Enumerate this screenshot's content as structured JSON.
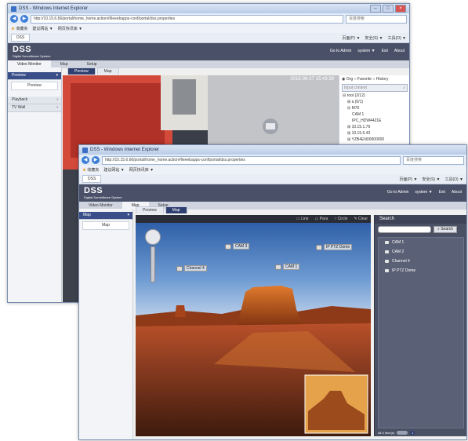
{
  "back_window": {
    "title": "DSS - Windows Internet Explorer",
    "url": "http://10.15.6.66/portal/home_home.action#/lleeebapps-conf/portal/dss.properties",
    "search_placeholder": "百度搜索",
    "fav_items": [
      "收藏夹",
      "建议网站 ▼",
      "网页快讯库 ▼"
    ],
    "tab": "DSS",
    "tools": [
      "页面(P) ▼",
      "安全(S) ▼",
      "工具(O) ▼"
    ],
    "app": {
      "logo": "DSS",
      "subtitle": "Digital Surveillance System",
      "links": [
        "Go to Admin",
        "system ▼",
        "Exit",
        "About"
      ],
      "menu": [
        "Video Monitor",
        "Map",
        "Setup"
      ],
      "left": {
        "group1": "Preview",
        "sub1": "Preview",
        "group2": "Playback",
        "group3": "TV Wall"
      },
      "subtabs": [
        "Preview",
        "Map"
      ],
      "timestamp": "2015-09-27 15:43:39",
      "tree_radios": [
        "Org",
        "Favorite",
        "History"
      ],
      "tree_search_placeholder": "Input content",
      "tree_rows": [
        "root (2/12)",
        "a (0/1)",
        "M70",
        "CAM 1",
        "IPC_HDW4421E",
        "10.15.1.79",
        "10.15.5.43",
        "YZB4EN00000000"
      ]
    }
  },
  "front_window": {
    "title": "DSS - Windows Internet Explorer",
    "url": "http://10.15.6.66/portal/home_home.action#lleeebapps-conf/portal/dss.properties",
    "search_placeholder": "百度搜索",
    "fav_items": [
      "收藏夹",
      "建议网站 ▼",
      "网页快讯库 ▼"
    ],
    "tab": "DSS",
    "tools": [
      "页面(P) ▼",
      "安全(S) ▼",
      "工具(O) ▼"
    ],
    "app": {
      "logo": "DSS",
      "subtitle": "Digital Surveillance System",
      "links": [
        "Go to Admin",
        "system ▼",
        "Exit",
        "About"
      ],
      "menu": [
        "Video Monitor",
        "Map",
        "Setup"
      ],
      "left": {
        "group1": "Map",
        "sub1": "Map"
      },
      "subtabs": [
        "Preview",
        "Map"
      ],
      "map_tools": [
        "Line",
        "Para",
        "Circle",
        "Clear"
      ],
      "markers": [
        "CAM 3",
        "IP PTZ Dome",
        "Channel 4",
        "CAM 1"
      ],
      "search_tab": "Search",
      "search_button": "Search",
      "results": [
        "CAM 1",
        "CAM 2",
        "Channel 4",
        "IP PTZ Dome"
      ],
      "pager_label": "All 4 item(s)",
      "pager_page": "1"
    }
  }
}
